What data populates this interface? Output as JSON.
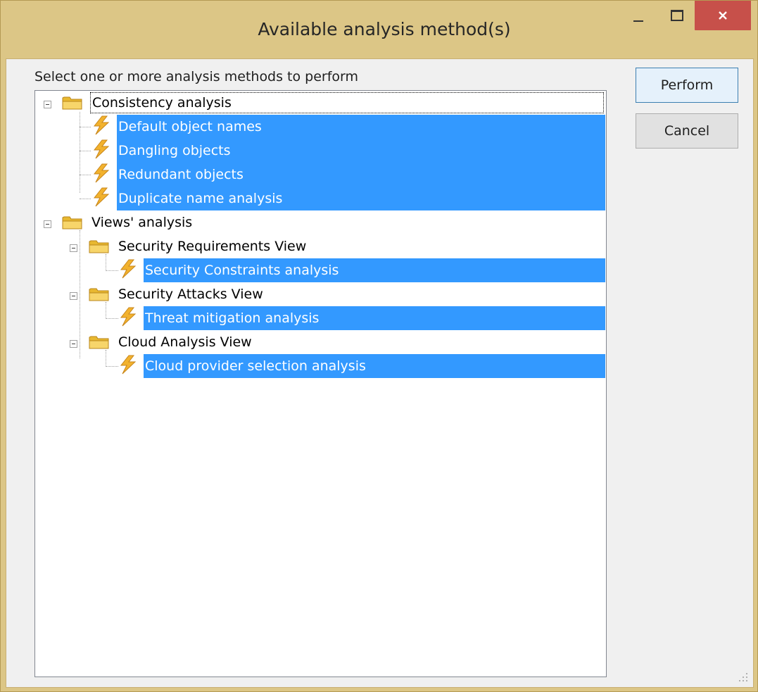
{
  "window": {
    "title": "Available analysis method(s)",
    "buttons": {
      "minimize": "minimize-icon",
      "maximize": "maximize-icon",
      "close": "close-icon"
    },
    "colors": {
      "frame": "#dcc686",
      "close": "#c7504a",
      "selection": "#3399ff"
    }
  },
  "dialog": {
    "prompt": "Select one or more analysis methods to perform",
    "perform_label": "Perform",
    "cancel_label": "Cancel"
  },
  "tree": {
    "consistency": {
      "label": "Consistency analysis",
      "children": [
        "Default object names",
        "Dangling objects",
        "Redundant objects",
        "Duplicate name analysis"
      ]
    },
    "views": {
      "label": "Views' analysis",
      "groups": [
        {
          "label": "Security Requirements View",
          "children": [
            "Security Constraints analysis"
          ]
        },
        {
          "label": "Security Attacks View",
          "children": [
            "Threat mitigation analysis"
          ]
        },
        {
          "label": "Cloud Analysis View",
          "children": [
            "Cloud provider selection analysis"
          ]
        }
      ]
    }
  }
}
